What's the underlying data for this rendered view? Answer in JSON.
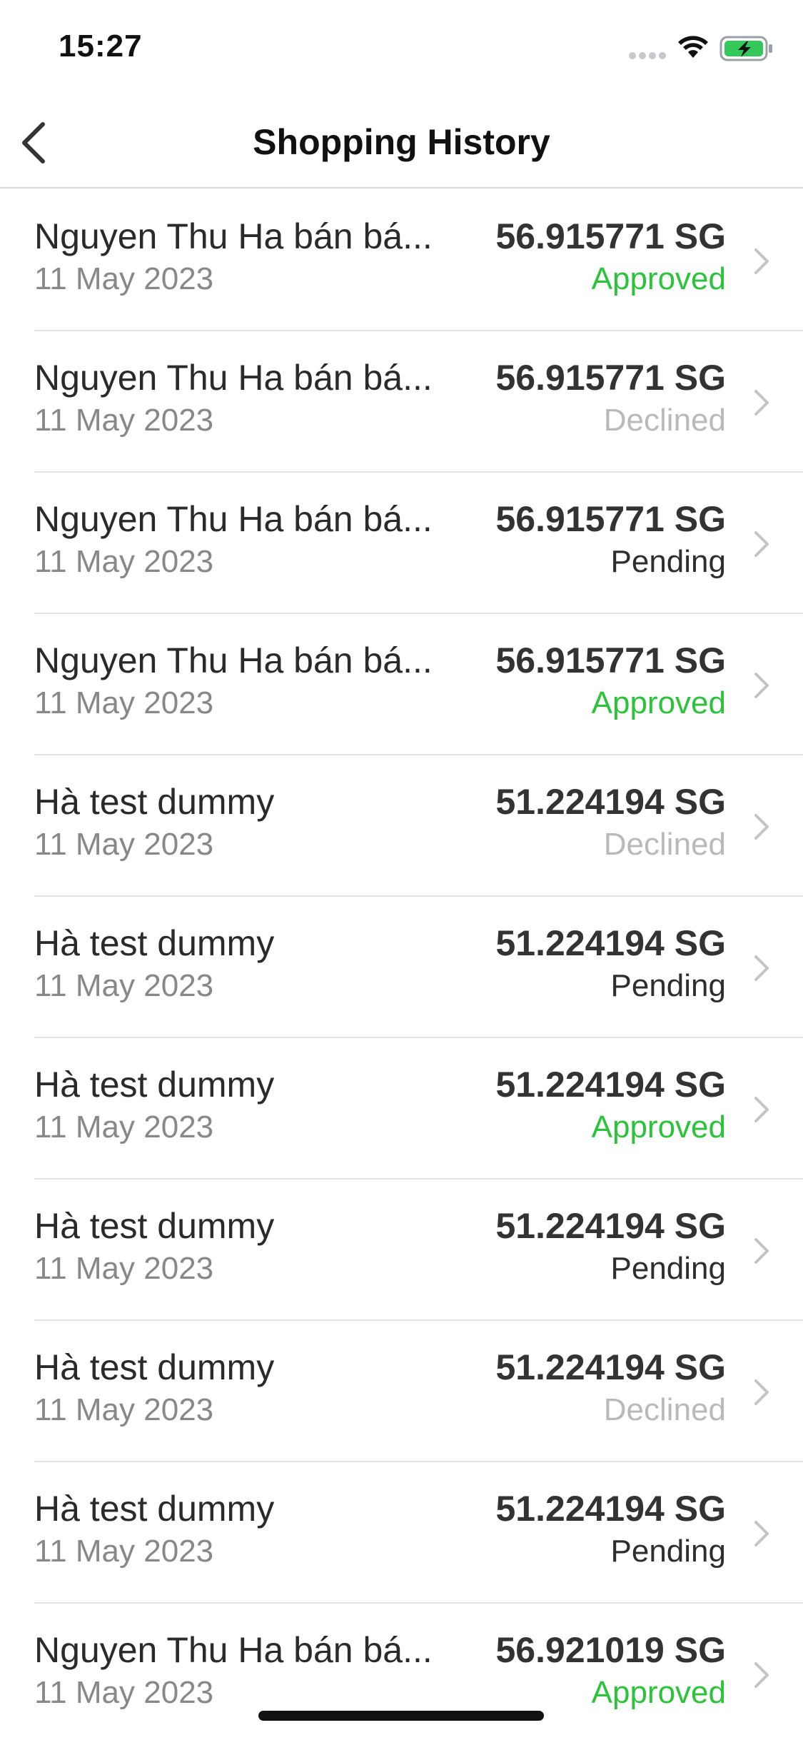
{
  "status_bar": {
    "time": "15:27",
    "icons": [
      "signal-dots-icon",
      "wifi-icon",
      "battery-charging-icon"
    ],
    "battery_color": "#34c759"
  },
  "nav": {
    "back_icon": "chevron-left-icon",
    "title": "Shopping History"
  },
  "colors": {
    "approved": "#2cc33b",
    "declined": "#b9b9b9",
    "pending": "#2e2e2e"
  },
  "items": [
    {
      "name": "Nguyen Thu Ha bán bá...",
      "date": "11 May 2023",
      "amount": "56.915771 SG",
      "status": "Approved"
    },
    {
      "name": "Nguyen Thu Ha bán bá...",
      "date": "11 May 2023",
      "amount": "56.915771 SG",
      "status": "Declined"
    },
    {
      "name": "Nguyen Thu Ha bán bá...",
      "date": "11 May 2023",
      "amount": "56.915771 SG",
      "status": "Pending"
    },
    {
      "name": "Nguyen Thu Ha bán bá...",
      "date": "11 May 2023",
      "amount": "56.915771 SG",
      "status": "Approved"
    },
    {
      "name": "Hà test dummy",
      "date": "11 May 2023",
      "amount": "51.224194 SG",
      "status": "Declined"
    },
    {
      "name": "Hà test dummy",
      "date": "11 May 2023",
      "amount": "51.224194 SG",
      "status": "Pending"
    },
    {
      "name": "Hà test dummy",
      "date": "11 May 2023",
      "amount": "51.224194 SG",
      "status": "Approved"
    },
    {
      "name": "Hà test dummy",
      "date": "11 May 2023",
      "amount": "51.224194 SG",
      "status": "Pending"
    },
    {
      "name": "Hà test dummy",
      "date": "11 May 2023",
      "amount": "51.224194 SG",
      "status": "Declined"
    },
    {
      "name": "Hà test dummy",
      "date": "11 May 2023",
      "amount": "51.224194 SG",
      "status": "Pending"
    },
    {
      "name": "Nguyen Thu Ha bán bá...",
      "date": "11 May 2023",
      "amount": "56.921019 SG",
      "status": "Approved"
    }
  ]
}
